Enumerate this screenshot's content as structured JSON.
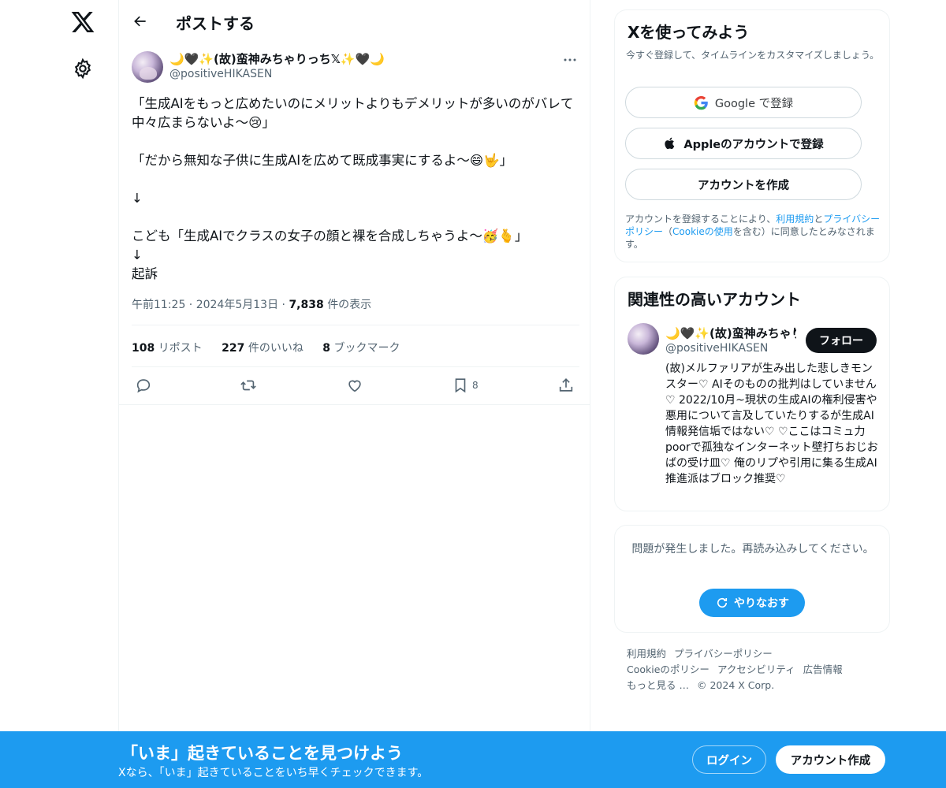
{
  "header": {
    "title": "ポストする"
  },
  "post": {
    "author_name": "🌙🖤✨(故)蛮神みちゃりっち𝕏✨🖤🌙",
    "author_handle": "@positiveHIKASEN",
    "text": "「生成AIをもっと広めたいのにメリットよりもデメリットが多いのがバレて中々広まらないよ〜😢」\n\n「だから無知な子供に生成AIを広めて既成事実にするよ〜😄🤟」\n\n↓\n\nこども「生成AIでクラスの女子の顔と裸を合成しちゃうよ〜🥳🫰」\n↓\n起訴",
    "time": "午前11:25",
    "date": "2024年5月13日",
    "views_count": "7,838",
    "views_label": "件の表示",
    "reposts_count": "108",
    "reposts_label": "リポスト",
    "likes_count": "227",
    "likes_label": "件のいいね",
    "bookmarks_count": "8",
    "bookmarks_label": "ブックマーク",
    "bookmark_action_count": "8"
  },
  "signup": {
    "title": "Xを使ってみよう",
    "subtitle": "今すぐ登録して、タイムラインをカスタマイズしましょう。",
    "google_label": "Google で登録",
    "apple_label": "Appleのアカウントで登録",
    "create_label": "アカウントを作成",
    "terms_prefix": "アカウントを登録することにより、",
    "terms_link": "利用規約",
    "terms_and": "と",
    "privacy_link": "プライバシーポリシー",
    "terms_open": "（",
    "cookie_link": "Cookieの使用",
    "terms_suffix": "を含む）に同意したとみなされます。"
  },
  "related": {
    "title": "関連性の高いアカウント",
    "name": "🌙🖤✨(故)蛮神みちゃりっち𝕏✨🖤🌙",
    "handle": "@positiveHIKASEN",
    "follow_label": "フォロー",
    "bio": "(故)メルファリアが生み出した悲しきモンスター♡ AIそのものの批判はしていません♡ 2022/10月~現状の生成AIの権利侵害や悪用について言及していたりするが生成AI情報発信垢ではない♡ ♡ここはコミュ力poorで孤独なインターネット壁打ちおじおばの受け皿♡ 俺のリプや引用に集る生成AI推進派はブロック推奨♡"
  },
  "error": {
    "message": "問題が発生しました。再読み込みしてください。",
    "retry_label": "やりなおす"
  },
  "footer": {
    "links": [
      "利用規約",
      "プライバシーポリシー",
      "Cookieのポリシー",
      "アクセシビリティ",
      "広告情報",
      "もっと見る …"
    ],
    "copyright": "© 2024 X Corp."
  },
  "banner": {
    "title": "「いま」起きていることを見つけよう",
    "subtitle": "Xなら、「いま」起きていることをいち早くチェックできます。",
    "login_label": "ログイン",
    "signup_label": "アカウント作成"
  },
  "colors": {
    "accent": "#1d9bf0",
    "text": "#0f1419",
    "secondary": "#536471",
    "border": "#eff3f4"
  },
  "icons": [
    "x-logo-icon",
    "gear-icon",
    "back-arrow-icon",
    "more-icon",
    "reply-icon",
    "repost-icon",
    "like-icon",
    "bookmark-icon",
    "share-icon",
    "google-icon",
    "apple-icon",
    "refresh-icon"
  ]
}
